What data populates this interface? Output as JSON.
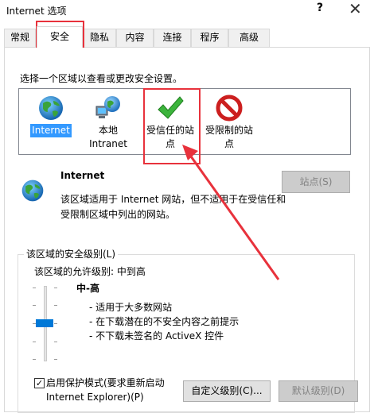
{
  "window": {
    "title": "Internet 选项",
    "help_glyph": "?",
    "close_glyph": "✕"
  },
  "tabs": [
    {
      "label": "常规",
      "active": false
    },
    {
      "label": "安全",
      "active": true
    },
    {
      "label": "隐私",
      "active": false
    },
    {
      "label": "内容",
      "active": false
    },
    {
      "label": "连接",
      "active": false
    },
    {
      "label": "程序",
      "active": false
    },
    {
      "label": "高级",
      "active": false
    }
  ],
  "security": {
    "instruction": "选择一个区域以查看或更改安全设置。",
    "zones": [
      {
        "label_lines": [
          "Internet"
        ],
        "icon": "globe-icon",
        "selected": true
      },
      {
        "label_lines": [
          "本地",
          "Intranet"
        ],
        "icon": "network-globe-icon",
        "selected": false
      },
      {
        "label_lines": [
          "受信任的站",
          "点"
        ],
        "icon": "checkmark-icon",
        "selected": false
      },
      {
        "label_lines": [
          "受限制的站",
          "点"
        ],
        "icon": "prohibited-icon",
        "selected": false
      }
    ],
    "zone_title": "Internet",
    "zone_description": "该区域适用于 Internet 网站，但不适用于在受信任和受限制区域中列出的网站。",
    "sites_button": "站点(S)",
    "level_group_label": "该区域的安全级别(L)",
    "allowed_levels": "该区域的允许级别: 中到高",
    "level_name": "中-高",
    "level_bullets": [
      "- 适用于大多数网站",
      "- 在下载潜在的不安全内容之前提示",
      "- 不下载未签名的 ActiveX 控件"
    ],
    "protected_mode_line1": "启用保护模式(要求重新启动",
    "protected_mode_line2": "Internet Explorer)(P)",
    "protected_mode_checked": true,
    "checkmark_glyph": "✓",
    "custom_level_button": "自定义级别(C)...",
    "default_level_button": "默认级别(D)"
  },
  "colors": {
    "selection": "#3399ff",
    "highlight": "#e8323c",
    "slider_thumb": "#0078d7"
  }
}
